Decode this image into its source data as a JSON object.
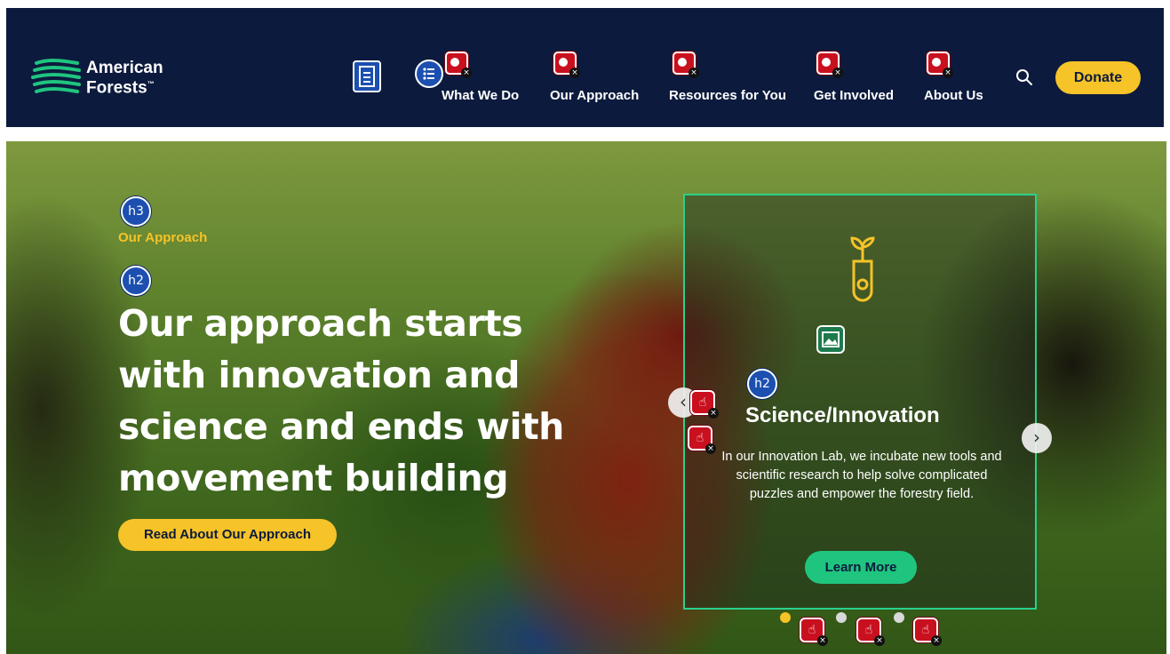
{
  "brand": {
    "name_line1": "American",
    "name_line2": "Forests",
    "trademark": "™",
    "color": "#1fc57f"
  },
  "nav": {
    "items": [
      {
        "label": "What We Do"
      },
      {
        "label": "Our Approach"
      },
      {
        "label": "Resources for You"
      },
      {
        "label": "Get Involved"
      },
      {
        "label": "About Us"
      }
    ],
    "search_icon": "search-icon",
    "donate_label": "Donate"
  },
  "hero": {
    "eyebrow": "Our Approach",
    "title": "Our approach starts with innovation and science and ends with movement building",
    "cta_label": "Read About Our Approach"
  },
  "card": {
    "icon": "sprout-test-tube-icon",
    "title": "Science/Innovation",
    "text": "In our Innovation Lab, we incubate new tools and scientific research to help solve complicated puzzles and empower the forestry field.",
    "button_label": "Learn More"
  },
  "carousel": {
    "slides": 3,
    "active_index": 1,
    "prev_label": "‹",
    "next_label": "›"
  },
  "overlay_badges": {
    "h3": "h3",
    "h2": "h2",
    "x": "×"
  },
  "colors": {
    "navy": "#0c1b3d",
    "yellow": "#f6c328",
    "green": "#1fc57f",
    "error_red": "#c9101f"
  }
}
